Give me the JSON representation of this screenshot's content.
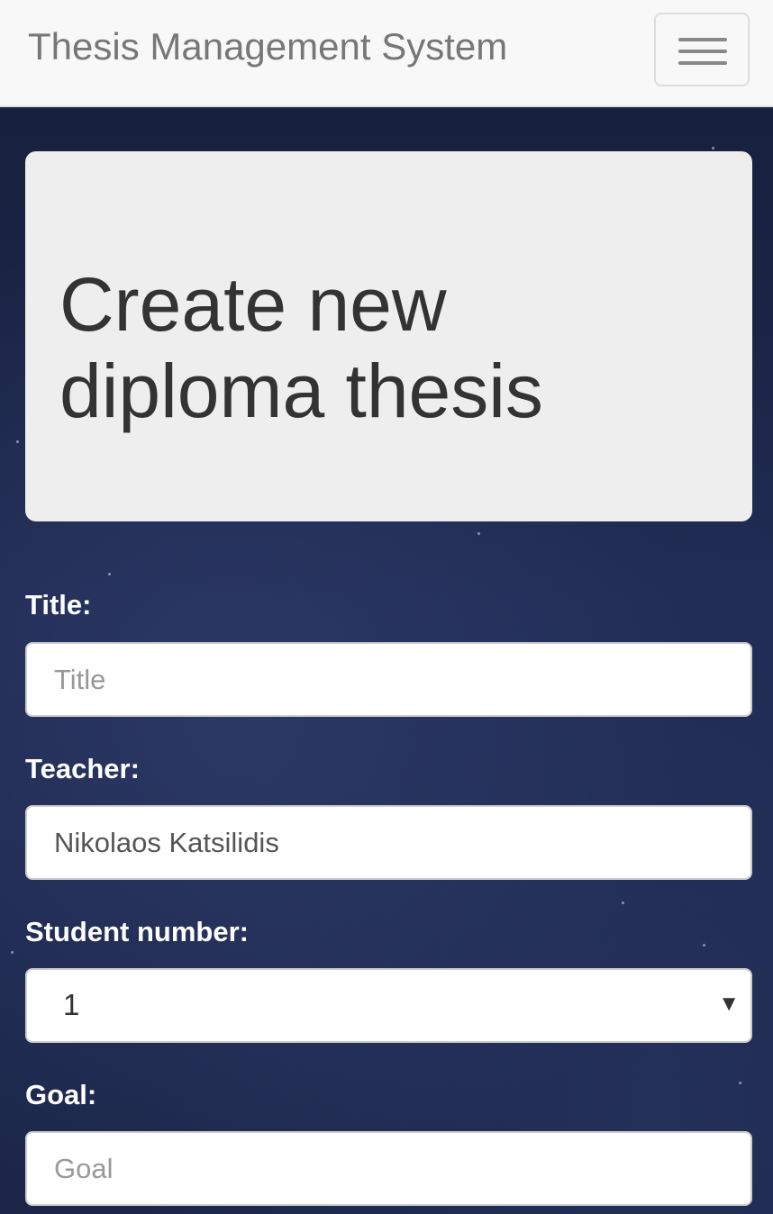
{
  "navbar": {
    "brand": "Thesis Management System",
    "toggle_icon": "hamburger-menu-icon"
  },
  "jumbotron": {
    "heading": "Create new diploma thesis"
  },
  "form": {
    "title": {
      "label": "Title:",
      "placeholder": "Title",
      "value": ""
    },
    "teacher": {
      "label": "Teacher:",
      "value": "Nikolaos Katsilidis"
    },
    "student_number": {
      "label": "Student number:",
      "selected": "1",
      "arrow": "▼"
    },
    "goal": {
      "label": "Goal:",
      "placeholder": "Goal",
      "value": ""
    }
  },
  "colors": {
    "navbar_bg": "#f8f8f8",
    "background": "#1c2748",
    "jumbotron_bg": "#eeeeee",
    "label_text": "#ffffff"
  }
}
